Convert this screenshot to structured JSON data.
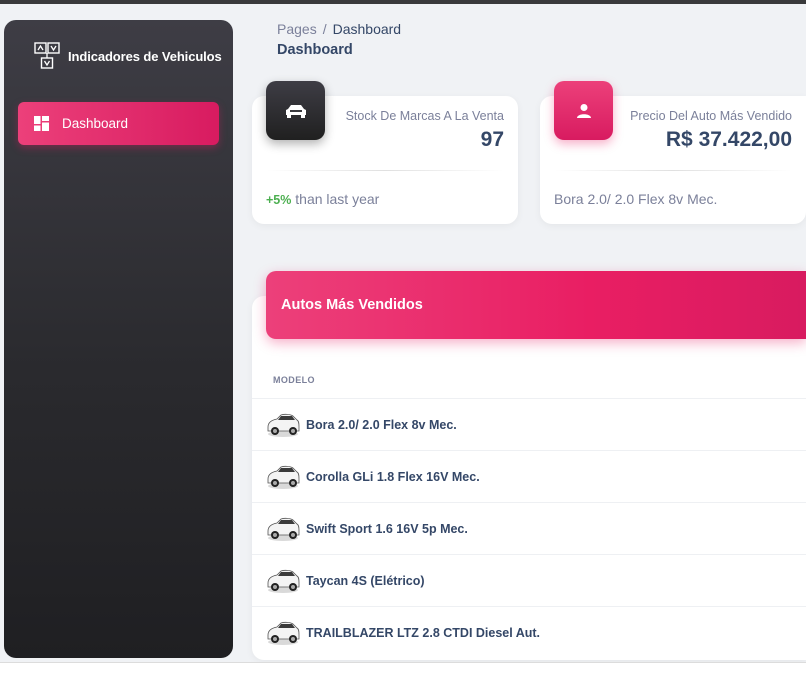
{
  "sidebar": {
    "brand": "Indicadores de Vehiculos",
    "brand_icon": "car-diagram-icon",
    "items": [
      {
        "label": "Dashboard",
        "icon": "dashboard-icon",
        "active": true
      }
    ],
    "colors": {
      "active": "#e91e63",
      "bg": "#2f2f33"
    }
  },
  "breadcrumb": {
    "root": "Pages",
    "separator": "/",
    "current": "Dashboard"
  },
  "page_title": "Dashboard",
  "stats": [
    {
      "icon": "car-icon",
      "label": "Stock De Marcas A La Venta",
      "value": "97",
      "footer_highlight": "+5%",
      "footer_text": "than last year"
    },
    {
      "icon": "person-icon",
      "label": "Precio Del Auto Más Vendido",
      "value": "R$ 37.422,00",
      "footer_text": "Bora 2.0/ 2.0 Flex 8v Mec."
    }
  ],
  "table": {
    "title": "Autos Más Vendidos",
    "column": "MODELO",
    "rows": [
      {
        "icon": "car-icon",
        "model": "Bora 2.0/ 2.0 Flex 8v Mec."
      },
      {
        "icon": "car-icon",
        "model": "Corolla GLi 1.8 Flex 16V Mec."
      },
      {
        "icon": "car-icon",
        "model": "Swift Sport 1.6 16V 5p Mec."
      },
      {
        "icon": "car-icon",
        "model": "Taycan 4S (Elétrico)"
      },
      {
        "icon": "car-icon",
        "model": "TRAILBLAZER LTZ 2.8 CTDI Diesel Aut."
      }
    ]
  }
}
